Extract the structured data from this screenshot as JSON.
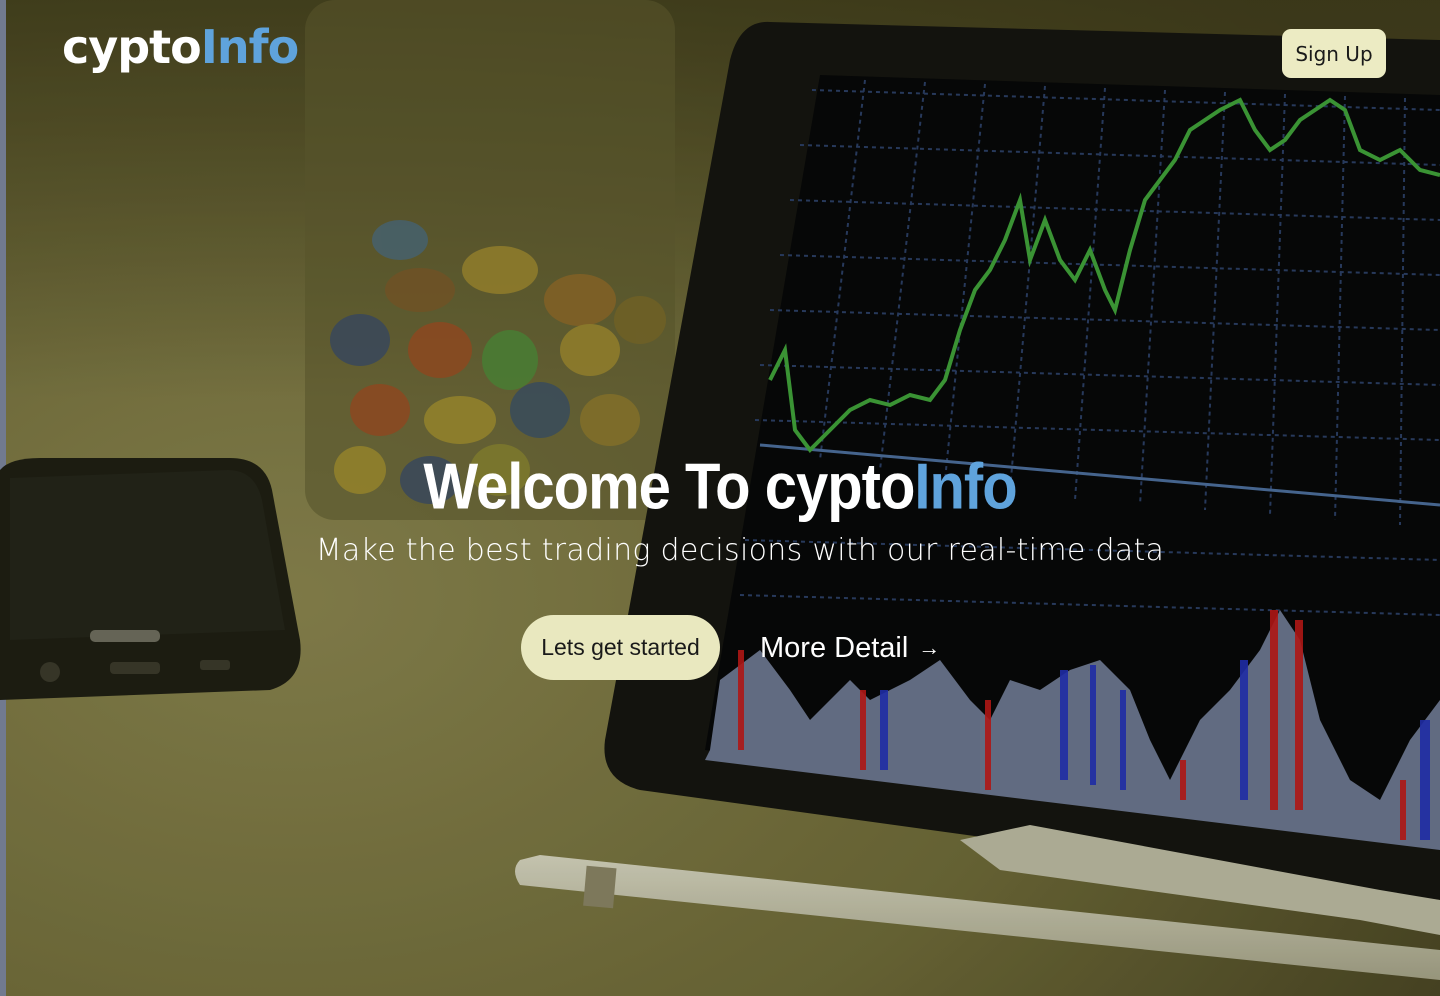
{
  "header": {
    "brand_main": "cypto",
    "brand_accent": "Info",
    "signup_label": "Sign Up"
  },
  "hero": {
    "title_main": "Welcome To cypto",
    "title_accent": "Info",
    "subtitle": "Make the best trading decisions with our real-time data",
    "cta_label": "Lets get started",
    "more_label": "More Detail",
    "more_arrow": "→"
  },
  "colors": {
    "accent": "#5fa3dc",
    "button_bg": "#ecebc3",
    "text": "#ffffff"
  }
}
